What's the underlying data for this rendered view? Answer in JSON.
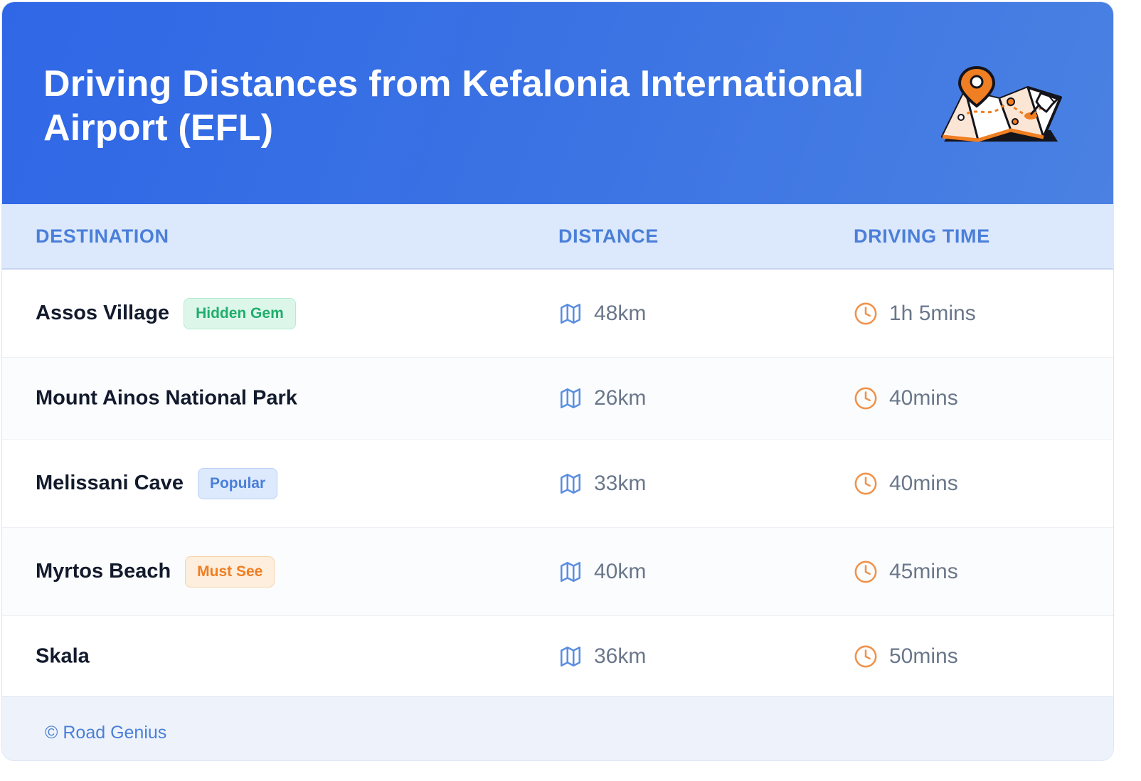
{
  "header": {
    "title": "Driving Distances from Kefalonia International Airport (EFL)",
    "icon": "map-pin-icon"
  },
  "table": {
    "columns": [
      "DESTINATION",
      "DISTANCE",
      "DRIVING TIME"
    ],
    "rows": [
      {
        "destination": "Assos Village",
        "badge": "Hidden Gem",
        "badge_color": "#1fae6c",
        "distance": "48km",
        "time": "1h 5mins"
      },
      {
        "destination": "Mount Ainos National Park",
        "badge": "",
        "distance": "26km",
        "time": "40mins"
      },
      {
        "destination": "Melissani Cave",
        "badge": "Popular",
        "badge_color": "#4a7fd9",
        "distance": "33km",
        "time": "40mins"
      },
      {
        "destination": "Myrtos Beach",
        "badge": "Must See",
        "badge_color": "#f07e22",
        "distance": "40km",
        "time": "45mins"
      },
      {
        "destination": "Skala",
        "badge": "",
        "distance": "36km",
        "time": "50mins"
      }
    ],
    "distance_icon": "map-icon",
    "time_icon": "clock-icon"
  },
  "footer": {
    "text": "© Road Genius"
  },
  "colors": {
    "header_gradient_start": "#2f67e6",
    "header_gradient_end": "#4a81e2",
    "accent_blue": "#4a7fd9",
    "accent_orange": "#f07e22"
  }
}
